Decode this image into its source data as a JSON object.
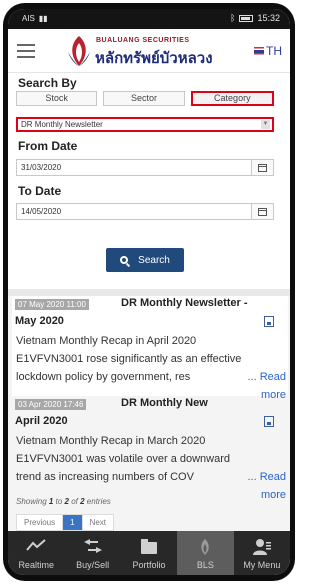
{
  "status": {
    "left": "AIS",
    "time": "15:32"
  },
  "header": {
    "brand_en": "BUALUANG SECURITIES",
    "brand_th": "หลักทรัพย์บัวหลวง",
    "lang": "TH"
  },
  "form": {
    "search_by_label": "Search By",
    "tabs": [
      {
        "label": "Stock"
      },
      {
        "label": "Sector"
      },
      {
        "label": "Category"
      }
    ],
    "active_tab": "Category",
    "category_value": "DR Monthly Newsletter",
    "from_label": "From Date",
    "from_value": "31/03/2020",
    "to_label": "To Date",
    "to_value": "14/05/2020",
    "search_button": "Search"
  },
  "results": [
    {
      "date": "07 May 2020 11:00",
      "title_1": "DR Monthly Newsletter -",
      "title_2": "May 2020",
      "line_1": "Vietnam Monthly Recap in April 2020",
      "line_2": "E1VFVN3001 rose significantly as an effective",
      "line_3": "lockdown policy by government, res",
      "read_1": "... Read",
      "read_2": "more"
    },
    {
      "date": "03 Apr 2020 17:46",
      "title_1": "DR Monthly New",
      "title_2": "April 2020",
      "line_1": "Vietnam Monthly Recap in March 2020",
      "line_2": "E1VFVN3001 was volatile over a downward",
      "line_3": "trend as increasing numbers of COV",
      "read_1": "... Read",
      "read_2": "more"
    }
  ],
  "pagination": {
    "showing_prefix": "Showing",
    "from": "1",
    "to_word": "to",
    "to": "2",
    "of_word": "of",
    "total": "2",
    "suffix": "entries",
    "previous": "Previous",
    "current": "1",
    "next": "Next"
  },
  "bottom_nav": [
    {
      "label": "Realtime",
      "icon": "line-chart-icon"
    },
    {
      "label": "Buy/Sell",
      "icon": "swap-arrows-icon"
    },
    {
      "label": "Portfolio",
      "icon": "folder-icon"
    },
    {
      "label": "BLS",
      "icon": "bls-logo-icon"
    },
    {
      "label": "My Menu",
      "icon": "user-menu-icon"
    }
  ],
  "colors": {
    "accent_red": "#e0001a",
    "search_button": "#214a7c",
    "link": "#2b63c9",
    "nav_bg": "#282828"
  }
}
